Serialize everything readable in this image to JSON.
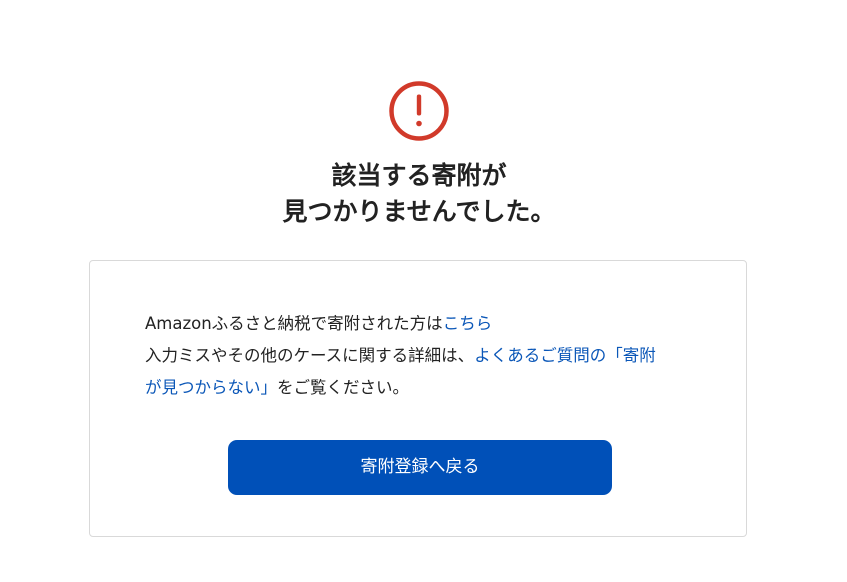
{
  "alert": {
    "icon": "exclamation-circle-icon",
    "color": "#d13a2a"
  },
  "heading": {
    "line1": "該当する寄附が",
    "line2": "見つかりませんでした。"
  },
  "message": {
    "line1_text": "Amazonふるさと納税で寄附された方は",
    "line1_link": "こちら",
    "line2_text": "入力ミスやその他のケースに関する詳細は、",
    "faq_link_part1": "よくあるご質問の「寄附",
    "faq_link_part2": "が見つからない」",
    "line3_text": "をご覧ください。"
  },
  "button": {
    "label": "寄附登録へ戻る",
    "color": "#0050b8"
  },
  "colors": {
    "link": "#0b57b8",
    "text": "#222222",
    "border": "#d9d9d9"
  }
}
